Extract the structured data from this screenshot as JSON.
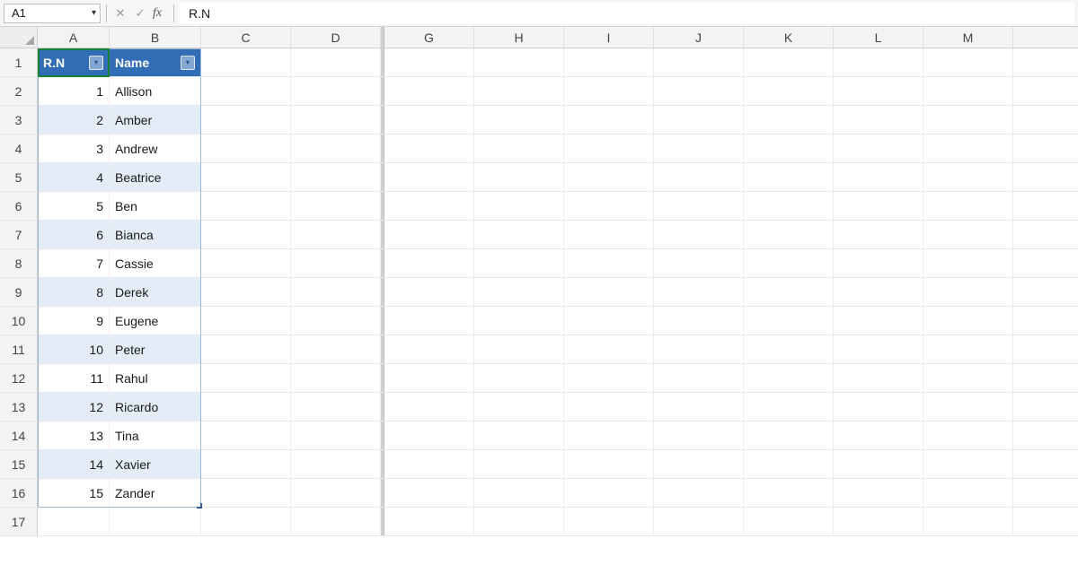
{
  "formula_bar": {
    "name_box": "A1",
    "formula": "R.N"
  },
  "column_headers": [
    "A",
    "B",
    "C",
    "D",
    "G",
    "H",
    "I",
    "J",
    "K",
    "L",
    "M"
  ],
  "row_headers": [
    1,
    2,
    3,
    4,
    5,
    6,
    7,
    8,
    9,
    10,
    11,
    12,
    13,
    14,
    15,
    16,
    17
  ],
  "table": {
    "headers": {
      "rn": "R.N",
      "name": "Name"
    },
    "rows": [
      {
        "rn": 1,
        "name": "Allison"
      },
      {
        "rn": 2,
        "name": "Amber"
      },
      {
        "rn": 3,
        "name": "Andrew"
      },
      {
        "rn": 4,
        "name": "Beatrice"
      },
      {
        "rn": 5,
        "name": "Ben"
      },
      {
        "rn": 6,
        "name": "Bianca"
      },
      {
        "rn": 7,
        "name": "Cassie"
      },
      {
        "rn": 8,
        "name": "Derek"
      },
      {
        "rn": 9,
        "name": "Eugene"
      },
      {
        "rn": 10,
        "name": "Peter"
      },
      {
        "rn": 11,
        "name": "Rahul"
      },
      {
        "rn": 12,
        "name": "Ricardo"
      },
      {
        "rn": 13,
        "name": "Tina"
      },
      {
        "rn": 14,
        "name": "Xavier"
      },
      {
        "rn": 15,
        "name": "Zander"
      }
    ]
  },
  "colors": {
    "table_header_bg": "#326eb5",
    "band_bg": "#e4edf7",
    "active_border": "#188038"
  }
}
